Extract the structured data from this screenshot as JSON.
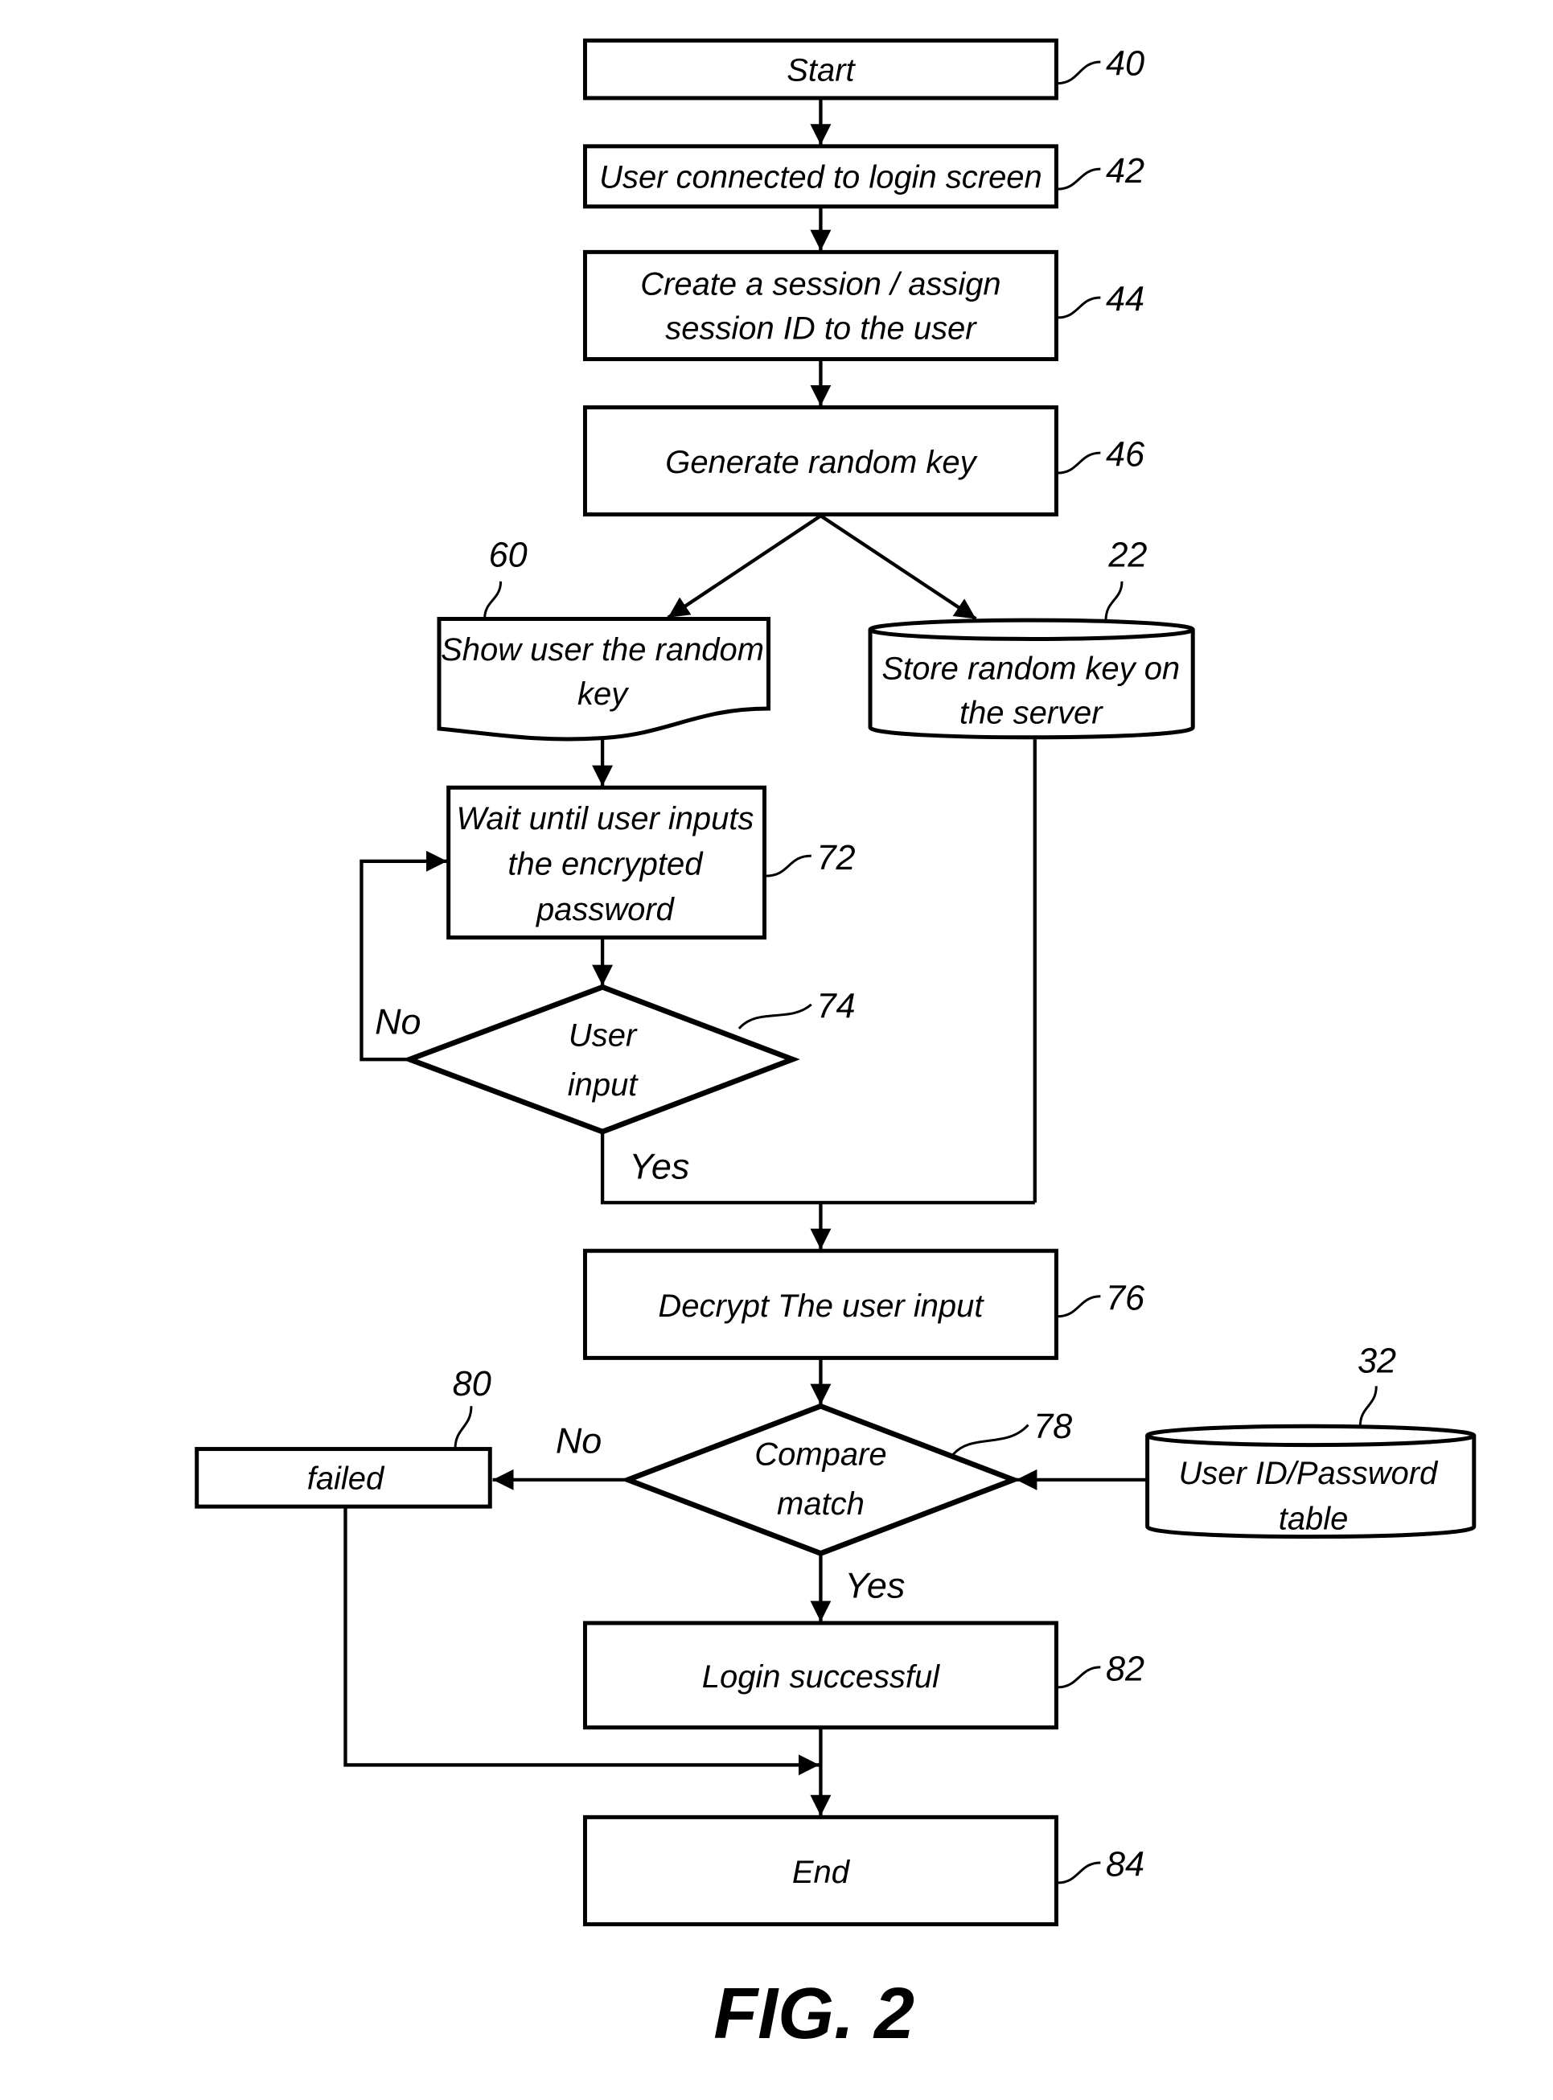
{
  "figure_label": "FIG. 2",
  "nodes": {
    "start": {
      "text": "Start",
      "ref": "40",
      "type": "process"
    },
    "connected": {
      "text": "User connected to login screen",
      "ref": "42",
      "type": "process"
    },
    "session": {
      "lines": [
        "Create a session / assign",
        "session ID to the user"
      ],
      "ref": "44",
      "type": "process"
    },
    "genkey": {
      "text": "Generate random key",
      "ref": "46",
      "type": "process"
    },
    "showkey": {
      "lines": [
        "Show user the random",
        "key"
      ],
      "ref": "60",
      "type": "document"
    },
    "storekey": {
      "lines": [
        "Store random key on",
        "the server"
      ],
      "ref": "22",
      "type": "database"
    },
    "wait": {
      "lines": [
        "Wait until user inputs",
        "the encrypted",
        "password"
      ],
      "ref": "72",
      "type": "process"
    },
    "userinput": {
      "lines": [
        "User",
        "input"
      ],
      "ref": "74",
      "type": "decision"
    },
    "decrypt": {
      "text": "Decrypt The user input",
      "ref": "76",
      "type": "process"
    },
    "compare": {
      "lines": [
        "Compare",
        "match"
      ],
      "ref": "78",
      "type": "decision"
    },
    "failed": {
      "text": "failed",
      "ref": "80",
      "type": "process"
    },
    "table": {
      "lines": [
        "User ID/Password",
        "table"
      ],
      "ref": "32",
      "type": "database"
    },
    "success": {
      "text": "Login successful",
      "ref": "82",
      "type": "process"
    },
    "end": {
      "text": "End",
      "ref": "84",
      "type": "process"
    }
  },
  "edge_labels": {
    "userinput_no": "No",
    "userinput_yes": "Yes",
    "compare_no": "No",
    "compare_yes": "Yes"
  }
}
